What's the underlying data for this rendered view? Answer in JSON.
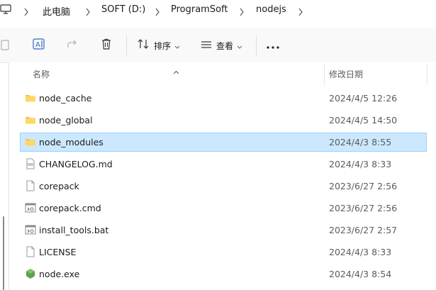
{
  "breadcrumb": [
    "此电脑",
    "SOFT (D:)",
    "ProgramSoft",
    "nodejs"
  ],
  "toolbar": {
    "sort_label": "排序",
    "view_label": "查看"
  },
  "columns": {
    "name": "名称",
    "modified": "修改日期"
  },
  "files": [
    {
      "name": "node_cache",
      "date": "2024/4/5 12:26",
      "icon": "folder-icon",
      "selected": false
    },
    {
      "name": "node_global",
      "date": "2024/4/5 14:50",
      "icon": "folder-icon",
      "selected": false
    },
    {
      "name": "node_modules",
      "date": "2024/4/3 8:55",
      "icon": "folder-icon",
      "selected": true
    },
    {
      "name": "CHANGELOG.md",
      "date": "2024/4/3 8:33",
      "icon": "markdown-file-icon",
      "selected": false
    },
    {
      "name": "corepack",
      "date": "2023/6/27 2:56",
      "icon": "file-icon",
      "selected": false
    },
    {
      "name": "corepack.cmd",
      "date": "2023/6/27 2:56",
      "icon": "cmd-file-icon",
      "selected": false
    },
    {
      "name": "install_tools.bat",
      "date": "2023/6/27 2:57",
      "icon": "bat-file-icon",
      "selected": false
    },
    {
      "name": "LICENSE",
      "date": "2024/4/3 8:33",
      "icon": "file-icon",
      "selected": false
    },
    {
      "name": "node.exe",
      "date": "2024/4/3 8:54",
      "icon": "node-exe-icon",
      "selected": false
    }
  ],
  "colors": {
    "selected_bg": "#cce8ff",
    "selected_border": "#99d1ff",
    "folder": "#f5c04a"
  }
}
